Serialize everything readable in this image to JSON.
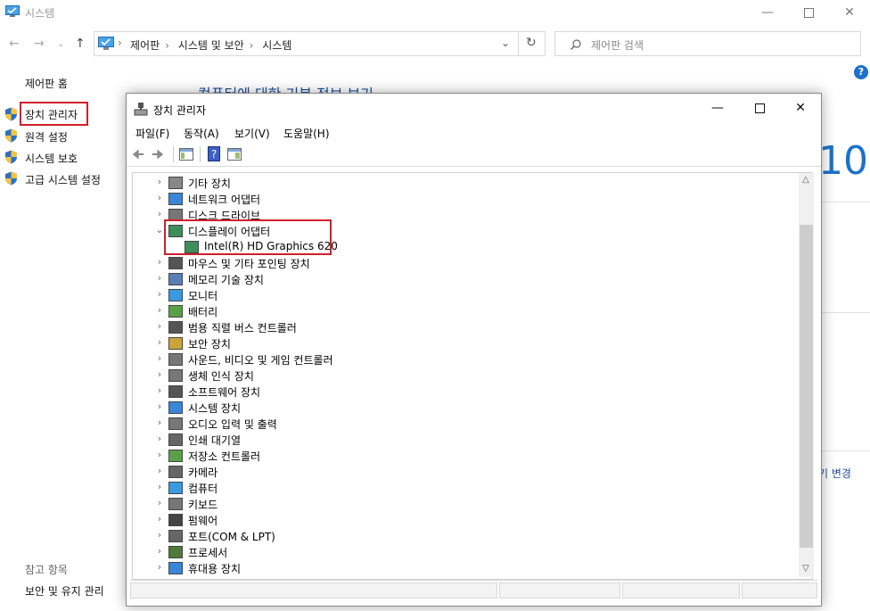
{
  "outer": {
    "title": "시스템",
    "address_crumbs": [
      "제어판",
      "시스템 및 보안",
      "시스템"
    ],
    "search_placeholder": "제어판 검색",
    "left_pane": {
      "home": "제어판 홈",
      "links": [
        "장치 관리자",
        "원격 설정",
        "시스템 보호",
        "고급 시스템 설정"
      ],
      "see_also": "참고 항목",
      "security": "보안 및 유지 관리"
    },
    "heading": "컴퓨터에 대한 기본 정보 보기",
    "partial_ten": "10",
    "partial_change": "기 변경",
    "help_glyph": "?"
  },
  "device_manager": {
    "title": "장치 관리자",
    "menu": [
      "파일(F)",
      "동작(A)",
      "보기(V)",
      "도움말(H)"
    ],
    "tree": [
      {
        "label": "기타 장치",
        "expanded": false,
        "icon": "unknown-device-icon"
      },
      {
        "label": "네트워크 어댑터",
        "expanded": false,
        "icon": "network-icon"
      },
      {
        "label": "디스크 드라이브",
        "expanded": false,
        "icon": "disk-icon"
      },
      {
        "label": "디스플레이 어댑터",
        "expanded": true,
        "icon": "display-adapter-icon",
        "highlighted": true
      },
      {
        "label": "Intel(R) HD Graphics 620",
        "child": true,
        "icon": "display-adapter-icon",
        "highlighted": true
      },
      {
        "label": "마우스 및 기타 포인팅 장치",
        "expanded": false,
        "icon": "mouse-icon"
      },
      {
        "label": "메모리 기술 장치",
        "expanded": false,
        "icon": "memory-icon"
      },
      {
        "label": "모니터",
        "expanded": false,
        "icon": "monitor-icon"
      },
      {
        "label": "배터리",
        "expanded": false,
        "icon": "battery-icon"
      },
      {
        "label": "범용 직렬 버스 컨트롤러",
        "expanded": false,
        "icon": "usb-icon"
      },
      {
        "label": "보안 장치",
        "expanded": false,
        "icon": "security-device-icon"
      },
      {
        "label": "사운드, 비디오 및 게임 컨트롤러",
        "expanded": false,
        "icon": "sound-icon"
      },
      {
        "label": "생체 인식 장치",
        "expanded": false,
        "icon": "fingerprint-icon"
      },
      {
        "label": "소프트웨어 장치",
        "expanded": false,
        "icon": "software-device-icon"
      },
      {
        "label": "시스템 장치",
        "expanded": false,
        "icon": "system-device-icon"
      },
      {
        "label": "오디오 입력 및 출력",
        "expanded": false,
        "icon": "speaker-icon"
      },
      {
        "label": "인쇄 대기열",
        "expanded": false,
        "icon": "printer-icon"
      },
      {
        "label": "저장소 컨트롤러",
        "expanded": false,
        "icon": "storage-controller-icon"
      },
      {
        "label": "카메라",
        "expanded": false,
        "icon": "camera-icon"
      },
      {
        "label": "컴퓨터",
        "expanded": false,
        "icon": "computer-icon"
      },
      {
        "label": "키보드",
        "expanded": false,
        "icon": "keyboard-icon"
      },
      {
        "label": "펌웨어",
        "expanded": false,
        "icon": "firmware-icon"
      },
      {
        "label": "포트(COM & LPT)",
        "expanded": false,
        "icon": "port-icon"
      },
      {
        "label": "프로세서",
        "expanded": false,
        "icon": "processor-icon"
      },
      {
        "label": "휴대용 장치",
        "expanded": false,
        "icon": "portable-device-icon"
      }
    ]
  },
  "colors": {
    "highlight": "#d11f2a",
    "accent": "#1a73c9"
  }
}
